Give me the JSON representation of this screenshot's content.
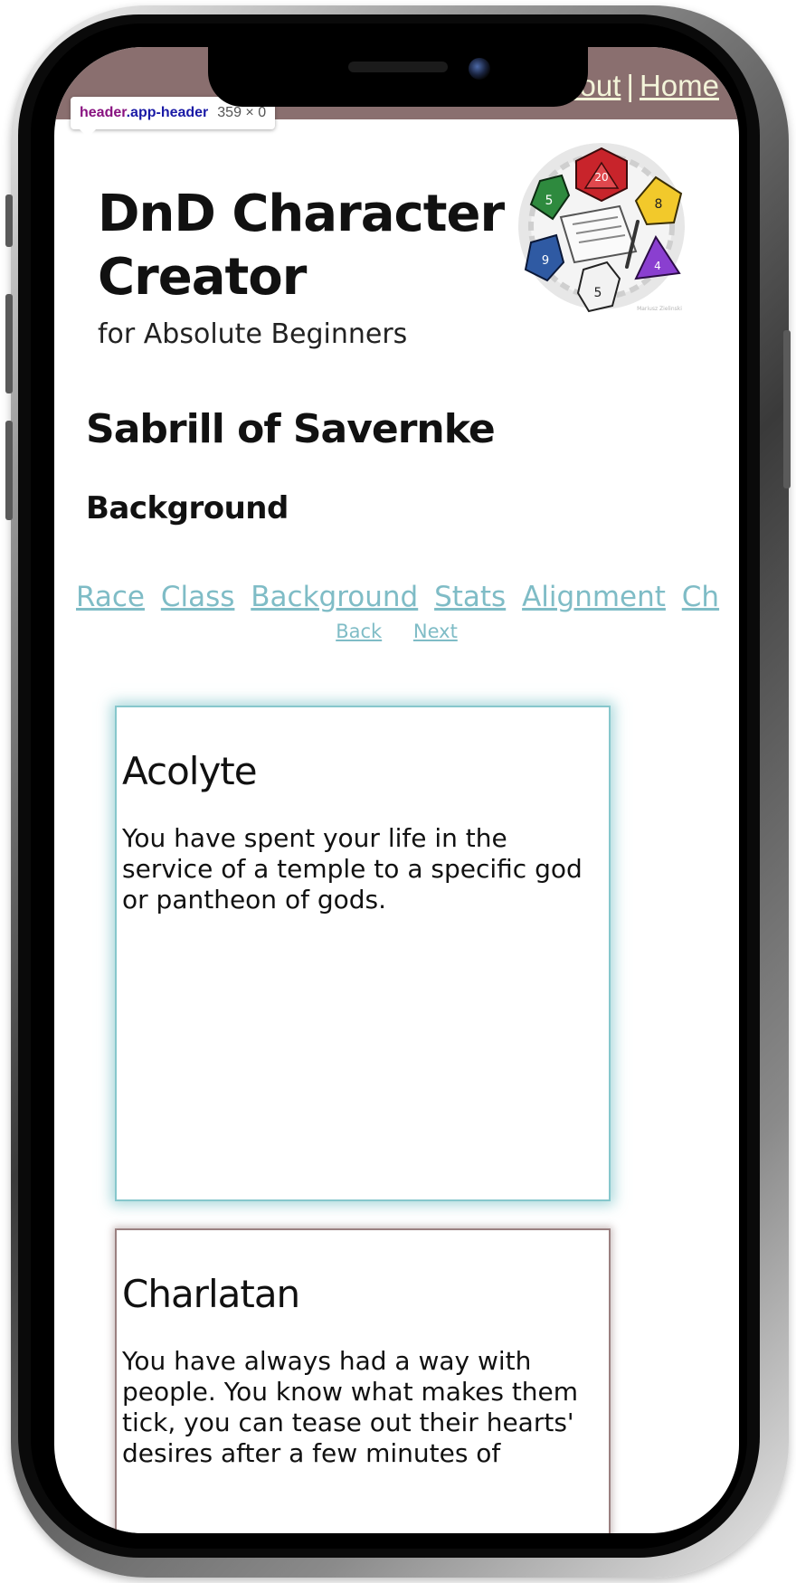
{
  "header": {
    "links": [
      "About",
      "Home"
    ],
    "separator": "|"
  },
  "devtools": {
    "tag": "header",
    "class": ".app-header",
    "size": "359 × 0"
  },
  "hero": {
    "title": "DnD Character Creator",
    "subtitle": "for Absolute Beginners",
    "logo": "dice-and-character-sheet-logo",
    "logo_credit": "Mariusz Zielinski"
  },
  "character": {
    "name": "Sabrill of Savernke",
    "section": "Background"
  },
  "steps": [
    "Race",
    "Class",
    "Background",
    "Stats",
    "Alignment",
    "Ch"
  ],
  "pager": {
    "back": "Back",
    "next": "Next"
  },
  "backgrounds": [
    {
      "name": "Acolyte",
      "description": "You have spent your life in the service of a temple to a specific god or pantheon of gods.",
      "selected": true
    },
    {
      "name": "Charlatan",
      "description": "You have always had a way with people. You know what makes them tick, you can tease out their hearts' desires after a few minutes of",
      "selected": false
    }
  ],
  "colors": {
    "header_bg": "#8a6f6f",
    "link": "#7fbcc6",
    "header_link": "#f3f4d9",
    "selected_border": "#86c7cc"
  }
}
